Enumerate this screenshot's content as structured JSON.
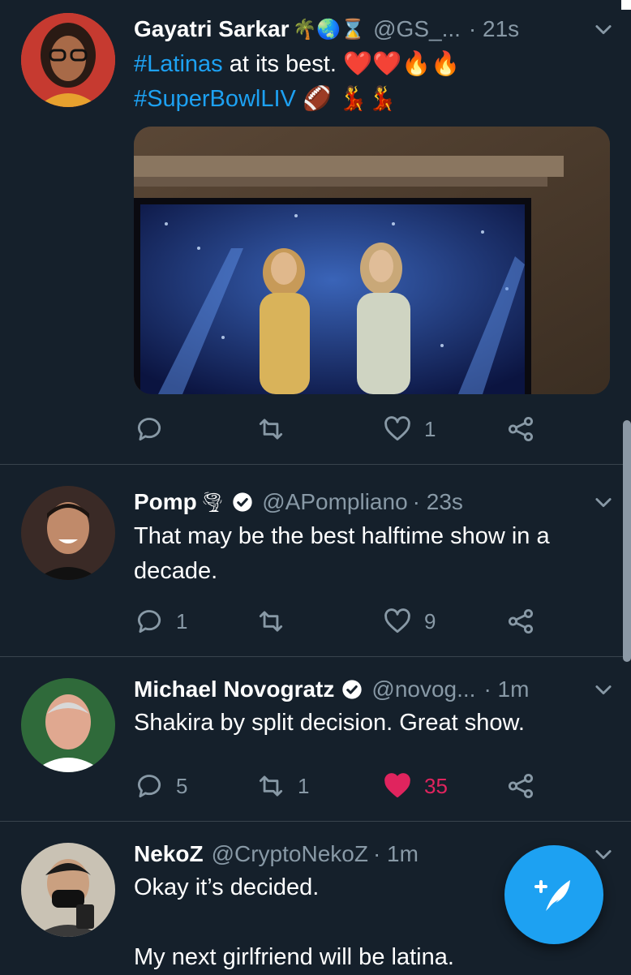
{
  "tweets": [
    {
      "name": "Gayatri Sarkar",
      "name_emoji": "🌴🌏⌛",
      "handle": "@GS_...",
      "time": "· 21s",
      "text_tag1": "#Latinas",
      "text_rest1": " at its best. ❤️❤️🔥🔥",
      "text_tag2": "#SuperBowlLIV",
      "text_rest2": " 🏈 💃💃",
      "actions": {
        "reply": "",
        "retweet": "",
        "like": "1"
      },
      "media": "photo of TV showing halftime performers"
    },
    {
      "name": "Pomp",
      "name_emoji": "🌪",
      "handle": "@APompliano",
      "time": "· 23s",
      "text": "That may be the best halftime show in a decade.",
      "actions": {
        "reply": "1",
        "retweet": "",
        "like": "9"
      }
    },
    {
      "name": "Michael Novogratz",
      "handle": "@novog...",
      "time": "· 1m",
      "text": "Shakira by split decision.  Great show.",
      "actions": {
        "reply": "5",
        "retweet": "1",
        "like": "35"
      }
    },
    {
      "name": "NekoZ",
      "handle": "@CryptoNekoZ",
      "time": "· 1m",
      "text_line1": "Okay it’s decided.",
      "text_line2": "My next girlfriend will be latina."
    }
  ],
  "colors": {
    "background": "#15202b",
    "accent": "#1da1f2",
    "like": "#e0245e",
    "muted": "#8899a6"
  },
  "icons": [
    "reply-icon",
    "retweet-icon",
    "like-icon",
    "share-icon",
    "chevron-down-icon",
    "verified-icon",
    "compose-icon"
  ]
}
